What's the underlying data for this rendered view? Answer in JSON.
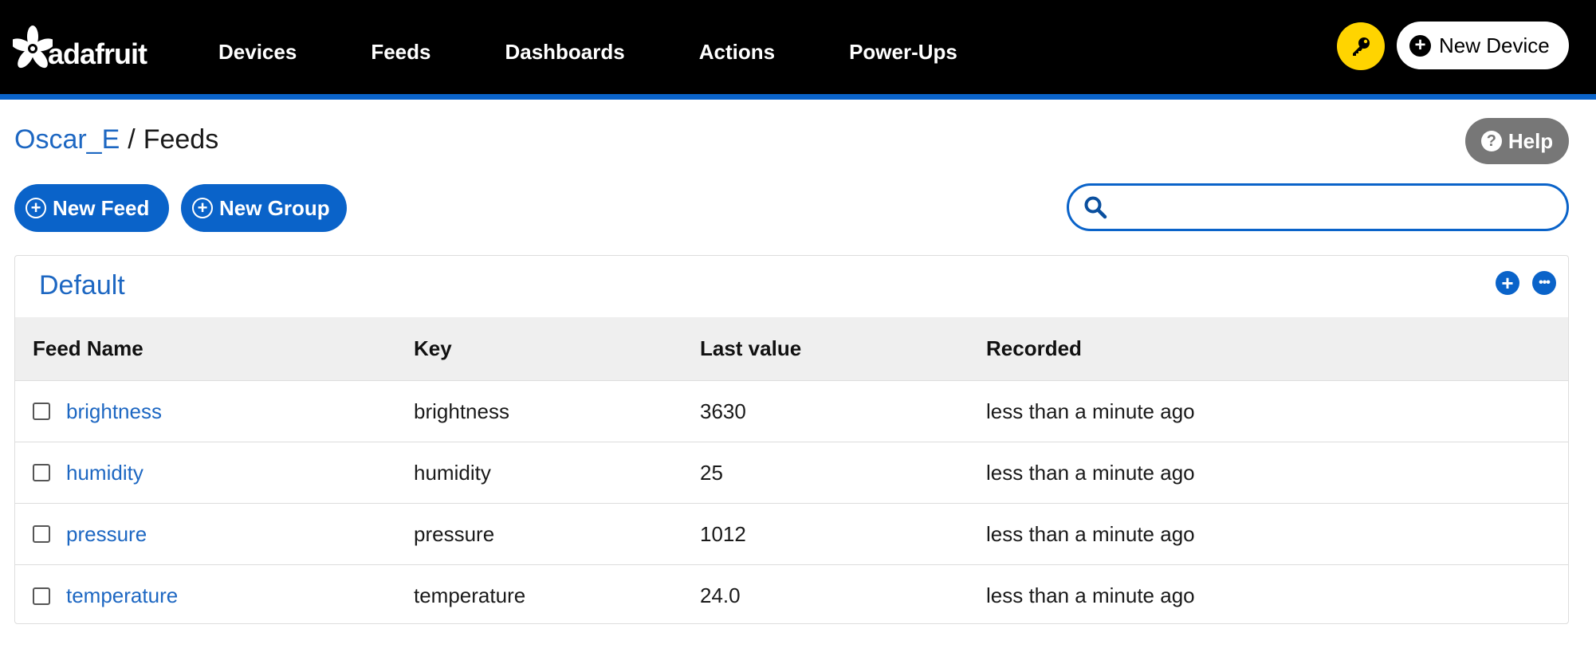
{
  "header": {
    "logo_text": "adafruit",
    "nav": [
      "Devices",
      "Feeds",
      "Dashboards",
      "Actions",
      "Power-Ups"
    ],
    "key_icon": "key-icon",
    "new_device_label": "New Device"
  },
  "breadcrumb": {
    "user": "Oscar_E",
    "separator": "/",
    "current": "Feeds"
  },
  "help_label": "Help",
  "actions": {
    "new_feed_label": "New Feed",
    "new_group_label": "New Group"
  },
  "search": {
    "placeholder": "",
    "value": ""
  },
  "group": {
    "name": "Default",
    "columns": [
      "Feed Name",
      "Key",
      "Last value",
      "Recorded"
    ],
    "rows": [
      {
        "name": "brightness",
        "key": "brightness",
        "last_value": "3630",
        "recorded": "less than a minute ago"
      },
      {
        "name": "humidity",
        "key": "humidity",
        "last_value": "25",
        "recorded": "less than a minute ago"
      },
      {
        "name": "pressure",
        "key": "pressure",
        "last_value": "1012",
        "recorded": "less than a minute ago"
      },
      {
        "name": "temperature",
        "key": "temperature",
        "last_value": "24.0",
        "recorded": "less than a minute ago"
      }
    ]
  },
  "colors": {
    "topbar": "#000000",
    "accent": "#0a63c9",
    "link": "#1d67c2",
    "key_button": "#ffd400",
    "help_button": "#777777"
  }
}
